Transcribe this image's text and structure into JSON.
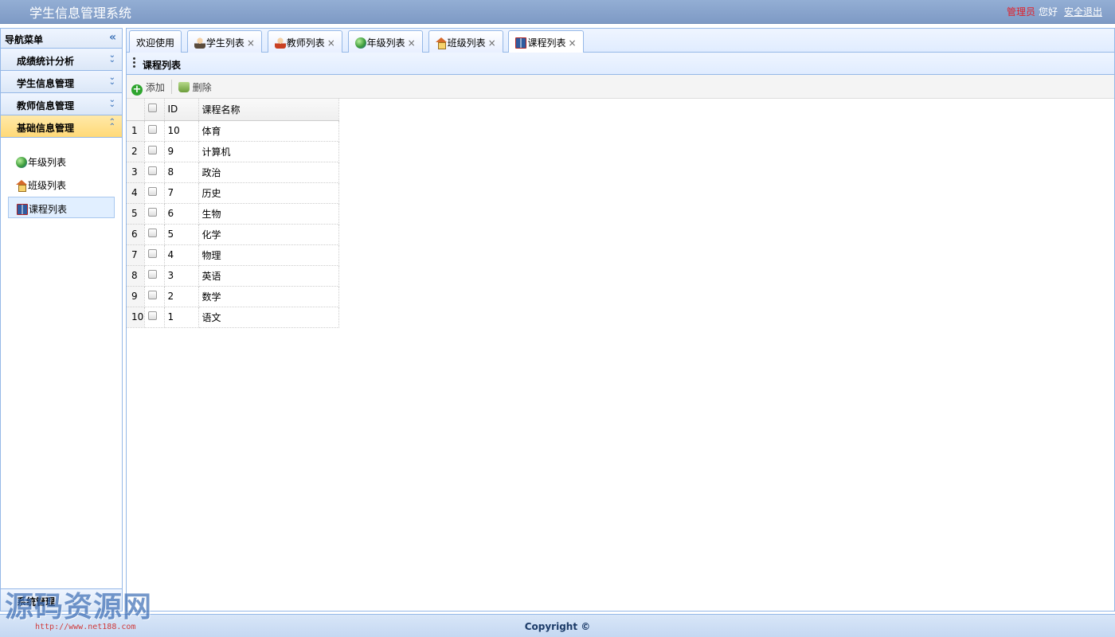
{
  "header": {
    "title": "学生信息管理系统",
    "user_role": "管理员",
    "greeting": "您好",
    "logout": "安全退出"
  },
  "nav": {
    "title": "导航菜单",
    "sections": [
      {
        "label": "成绩统计分析"
      },
      {
        "label": "学生信息管理"
      },
      {
        "label": "教师信息管理"
      },
      {
        "label": "基础信息管理"
      }
    ],
    "items": [
      {
        "label": "年级列表",
        "icon": "globe-icon"
      },
      {
        "label": "班级列表",
        "icon": "house-icon"
      },
      {
        "label": "课程列表",
        "icon": "book-icon"
      }
    ],
    "bottom_section": "系统管理"
  },
  "tabs": [
    {
      "label": "欢迎使用"
    },
    {
      "label": "学生列表",
      "icon": "student-icon"
    },
    {
      "label": "教师列表",
      "icon": "teacher-icon"
    },
    {
      "label": "年级列表",
      "icon": "globe-icon"
    },
    {
      "label": "班级列表",
      "icon": "house-icon"
    },
    {
      "label": "课程列表",
      "icon": "book-icon"
    }
  ],
  "tab_close": "×",
  "panel": {
    "title": "课程列表"
  },
  "toolbar": {
    "add": "添加",
    "delete": "删除"
  },
  "table": {
    "columns": [
      "ID",
      "课程名称"
    ],
    "rows": [
      {
        "rn": "1",
        "id": "10",
        "name": "体育"
      },
      {
        "rn": "2",
        "id": "9",
        "name": "计算机"
      },
      {
        "rn": "3",
        "id": "8",
        "name": "政治"
      },
      {
        "rn": "4",
        "id": "7",
        "name": "历史"
      },
      {
        "rn": "5",
        "id": "6",
        "name": "生物"
      },
      {
        "rn": "6",
        "id": "5",
        "name": "化学"
      },
      {
        "rn": "7",
        "id": "4",
        "name": "物理"
      },
      {
        "rn": "8",
        "id": "3",
        "name": "英语"
      },
      {
        "rn": "9",
        "id": "2",
        "name": "数学"
      },
      {
        "rn": "10",
        "id": "1",
        "name": "语文"
      }
    ]
  },
  "footer": {
    "copyright": "Copyright ©"
  },
  "watermark": {
    "text": "源码资源网",
    "url": "http://www.net188.com"
  }
}
